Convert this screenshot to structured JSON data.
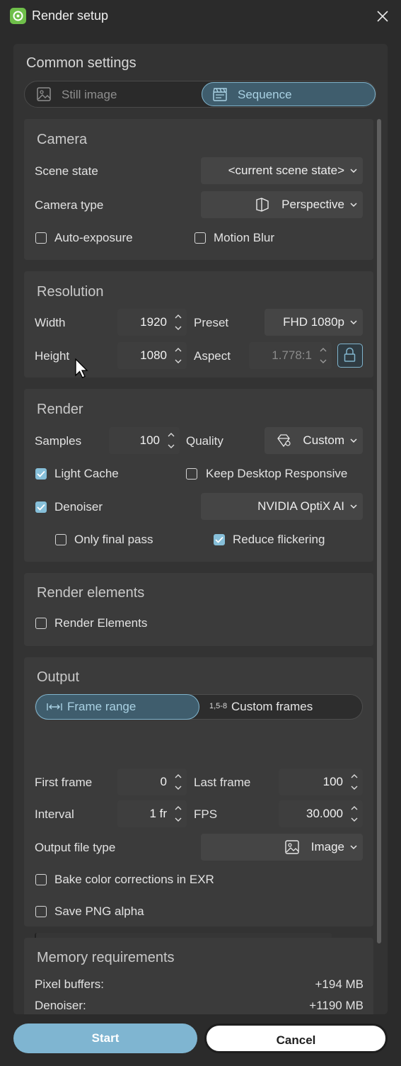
{
  "window": {
    "title": "Render setup"
  },
  "common": {
    "title": "Common settings",
    "mode_still": "Still image",
    "mode_sequence": "Sequence"
  },
  "camera": {
    "title": "Camera",
    "scene_state_label": "Scene state",
    "scene_state_value": "<current scene state>",
    "camera_type_label": "Camera type",
    "camera_type_value": "Perspective",
    "auto_exposure": "Auto-exposure",
    "motion_blur": "Motion Blur"
  },
  "resolution": {
    "title": "Resolution",
    "width_label": "Width",
    "width_value": "1920",
    "height_label": "Height",
    "height_value": "1080",
    "preset_label": "Preset",
    "preset_value": "FHD 1080p",
    "aspect_label": "Aspect",
    "aspect_value": "1.778:1"
  },
  "render": {
    "title": "Render",
    "samples_label": "Samples",
    "samples_value": "100",
    "quality_label": "Quality",
    "quality_value": "Custom",
    "light_cache": "Light Cache",
    "keep_responsive": "Keep Desktop Responsive",
    "denoiser": "Denoiser",
    "denoiser_value": "NVIDIA OptiX AI",
    "only_final_pass": "Only final pass",
    "reduce_flickering": "Reduce flickering"
  },
  "render_elements": {
    "title": "Render elements",
    "checkbox": "Render Elements"
  },
  "output": {
    "title": "Output",
    "frame_range": "Frame range",
    "custom_frames_prefix": "1,5-8",
    "custom_frames": "Custom frames",
    "first_frame_label": "First frame",
    "first_frame_value": "0",
    "last_frame_label": "Last frame",
    "last_frame_value": "100",
    "interval_label": "Interval",
    "interval_value": "1 fr",
    "fps_label": "FPS",
    "fps_value": "30.000",
    "file_type_label": "Output file type",
    "file_type_value": "Image",
    "bake_color": "Bake color corrections in EXR",
    "save_png_alpha": "Save PNG alpha"
  },
  "memory": {
    "title": "Memory requirements",
    "pixel_buffers_label": "Pixel buffers:",
    "pixel_buffers_value": "+194 MB",
    "denoiser_label": "Denoiser:",
    "denoiser_value": "+1190 MB"
  },
  "buttons": {
    "start": "Start",
    "cancel": "Cancel"
  },
  "checkbox_states": {
    "auto_exposure": false,
    "motion_blur": false,
    "light_cache": true,
    "keep_responsive": false,
    "denoiser": true,
    "only_final_pass": false,
    "reduce_flickering": true,
    "render_elements": false,
    "bake_color": false,
    "save_png_alpha": false
  },
  "colors": {
    "accent": "#80b4cd",
    "start_button": "#7fb5d1",
    "app_icon": "#6fbf4a"
  }
}
